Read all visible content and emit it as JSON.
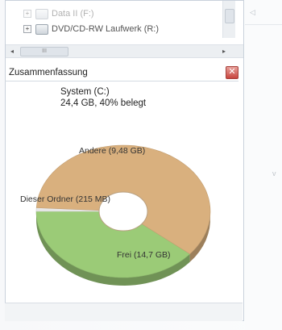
{
  "tree": {
    "items": [
      {
        "expander": "+",
        "label": "Data II (F:)"
      },
      {
        "expander": "+",
        "label": "DVD/CD-RW Laufwerk (R:)"
      }
    ]
  },
  "hscroll": {
    "left_arrow": "◂",
    "right_arrow": "▸",
    "thumb_grip": "III"
  },
  "summary": {
    "title": "Zusammenfassung",
    "close_icon": "close-icon",
    "system_line1": "System (C:)",
    "system_line2": "24,4 GB, 40% belegt"
  },
  "right_pane": {
    "nav_arrow": "◁",
    "letter": "v"
  },
  "chart_data": {
    "type": "pie",
    "style": "donut",
    "title": "",
    "slices": [
      {
        "label": "Andere (9,48 GB)",
        "value": 9.48,
        "color": "#9bcb77"
      },
      {
        "label": "Dieser Ordner (215 MB)",
        "value": 0.215,
        "color": "#e8e8e8"
      },
      {
        "label": "Frei (14,7 GB)",
        "value": 14.7,
        "color": "#d9b07e"
      }
    ],
    "legend": "none"
  },
  "colors": {
    "accent_close": "#c8453e",
    "used_green": "#9bcb77",
    "free_tan": "#d9b07e"
  }
}
